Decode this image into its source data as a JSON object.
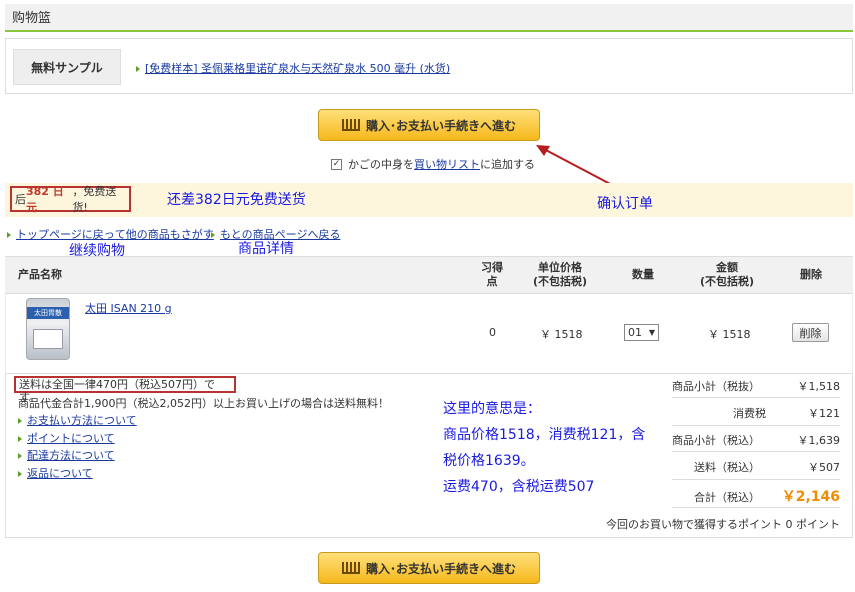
{
  "header": {
    "title": "购物篮"
  },
  "sample": {
    "label": "無料サンプル",
    "link": "[免费样本] 圣佩莱格里诺矿泉水与天然矿泉水 500 毫升 (水货)"
  },
  "checkout": {
    "button_label": "購入･お支払い手続きへ進む"
  },
  "wishlist": {
    "check": "✓",
    "prefix": "かごの中身を",
    "link": "買い物リスト",
    "suffix": "に追加する"
  },
  "shipping_bar": {
    "prefix": "后",
    "amount": "382 日元",
    "suffix": "，免费送货!"
  },
  "annotations": {
    "confirm": "确认订单",
    "remaining": "还差382日元免费送货",
    "continue": "继续购物",
    "detail": "商品详情",
    "explain_1": "这里的意思是：",
    "explain_2": "商品价格1518，消费税121，含",
    "explain_3": "税价格1639。",
    "explain_4": "运费470，含税运费507"
  },
  "nav": {
    "back_top": "トップページに戻って他の商品もさがす",
    "back_product": "もとの商品ページへ戻る"
  },
  "table": {
    "headers": {
      "name": "产品名称",
      "points_1": "习得",
      "points_2": "点",
      "unit_1": "单位价格",
      "unit_2": "(不包括税)",
      "qty": "数量",
      "amount_1": "金额",
      "amount_2": "(不包括税)",
      "delete": "删除"
    },
    "row": {
      "image_text": "太田胃散",
      "name": "太田 ISAN 210 g",
      "points": "0",
      "unit_price": "￥ 1518",
      "qty": "01",
      "amount": "￥ 1518",
      "delete_label": "削除"
    }
  },
  "notes": {
    "shipping": "送料は全国一律470円（税込507円）です。",
    "free": "商品代金合計1,900円（税込2,052円）以上お買い上げの場合は送料無料！",
    "links": [
      "お支払い方法について",
      "ポイントについて",
      "配達方法について",
      "返品について"
    ]
  },
  "summary": {
    "subtotal_excl_label": "商品小計（税抜）",
    "subtotal_excl": "￥1,518",
    "tax_label": "消费税",
    "tax": "￥121",
    "subtotal_incl_label": "商品小計（税込）",
    "subtotal_incl": "￥1,639",
    "shipping_label": "送料（税込）",
    "shipping": "￥507",
    "total_label": "合計（税込）",
    "total": "￥2,146",
    "points_note": "今回のお買い物で獲得するポイント 0 ポイント"
  }
}
